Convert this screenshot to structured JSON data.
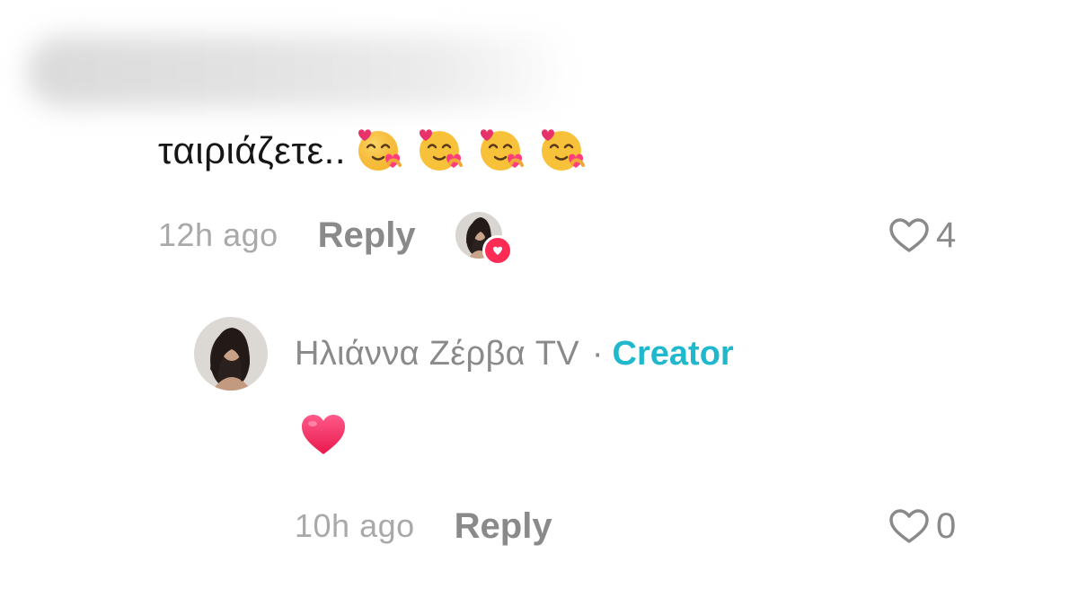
{
  "comment": {
    "text": "ταιριάζετε..",
    "emoji": [
      "smiling-face-with-hearts-hug",
      "smiling-face-with-hearts-hug",
      "smiling-face-with-hearts-hug",
      "smiling-face-with-hearts-hug"
    ],
    "time": "12h ago",
    "reply_label": "Reply",
    "like_count": "4"
  },
  "reply": {
    "author": "Ηλιάννα Ζέρβα TV",
    "separator": "·",
    "creator_label": "Creator",
    "time": "10h ago",
    "reply_label": "Reply",
    "like_count": "0"
  },
  "colors": {
    "creator_accent": "#20b8cc",
    "like_badge": "#fe2c55",
    "muted_text": "#8a8a8a",
    "time_text": "#a9a9a9"
  }
}
